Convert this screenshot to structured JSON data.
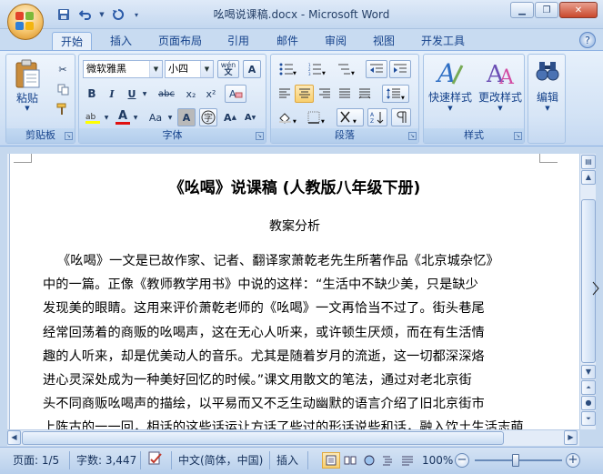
{
  "window": {
    "title": "吆喝说课稿.docx - Microsoft Word"
  },
  "qat": {
    "save_icon": "save-icon",
    "undo_icon": "undo-icon",
    "redo_icon": "redo-icon",
    "customize_icon": "customize-icon"
  },
  "tabs": [
    {
      "label": "开始",
      "active": true
    },
    {
      "label": "插入"
    },
    {
      "label": "页面布局"
    },
    {
      "label": "引用"
    },
    {
      "label": "邮件"
    },
    {
      "label": "审阅"
    },
    {
      "label": "视图"
    },
    {
      "label": "开发工具"
    }
  ],
  "ribbon": {
    "clipboard": {
      "label": "剪贴板",
      "paste_label": "粘贴"
    },
    "font": {
      "label": "字体",
      "font_name": "微软雅黑",
      "font_size": "小四",
      "wen": "wén",
      "A_box": "A",
      "bold": "B",
      "italic": "I",
      "underline": "U",
      "strike": "abc",
      "sub": "x₂",
      "sup": "x²",
      "color_A": "A",
      "aa": "Aa",
      "grow": "A",
      "shrink": "A"
    },
    "paragraph": {
      "label": "段落"
    },
    "styles": {
      "label": "样式",
      "quick": "快速样式",
      "change": "更改样式"
    },
    "editing": {
      "label": "编辑"
    }
  },
  "document": {
    "title": "《吆喝》说课稿 (人教版八年级下册)",
    "subtitle": "教案分析",
    "lines": [
      "《吆喝》一文是已故作家、记者、翻译家萧乾老先生所著作品《北京城杂忆》",
      "中的一篇。正像《教师教学用书》中说的这样：“生活中不缺少美，只是缺少",
      "发现美的眼睛。这用来评价萧乾老师的《吆喝》一文再恰当不过了。街头巷尾",
      "经常回荡着的商贩的吆喝声，这在无心人听来，或许顿生厌烦，而在有生活情",
      "趣的人听来，却是优美动人的音乐。尤其是随着岁月的流逝，这一切都深深烙",
      "进心灵深处成为一种美好回忆的时候。”课文用散文的笔法，通过对老北京街",
      "头不同商贩吆喝声的描绘，以平易而又不乏生动幽默的语言介绍了旧北京街市",
      "上陈古的一一回，相话的这些话运让方话了些过的形话说些和话，融入饮土生活志萌"
    ]
  },
  "status": {
    "page": "页面: 1/5",
    "words": "字数: 3,447",
    "language": "中文(简体，中国)",
    "mode": "插入",
    "zoom": "100%",
    "zoom_value": 100
  }
}
